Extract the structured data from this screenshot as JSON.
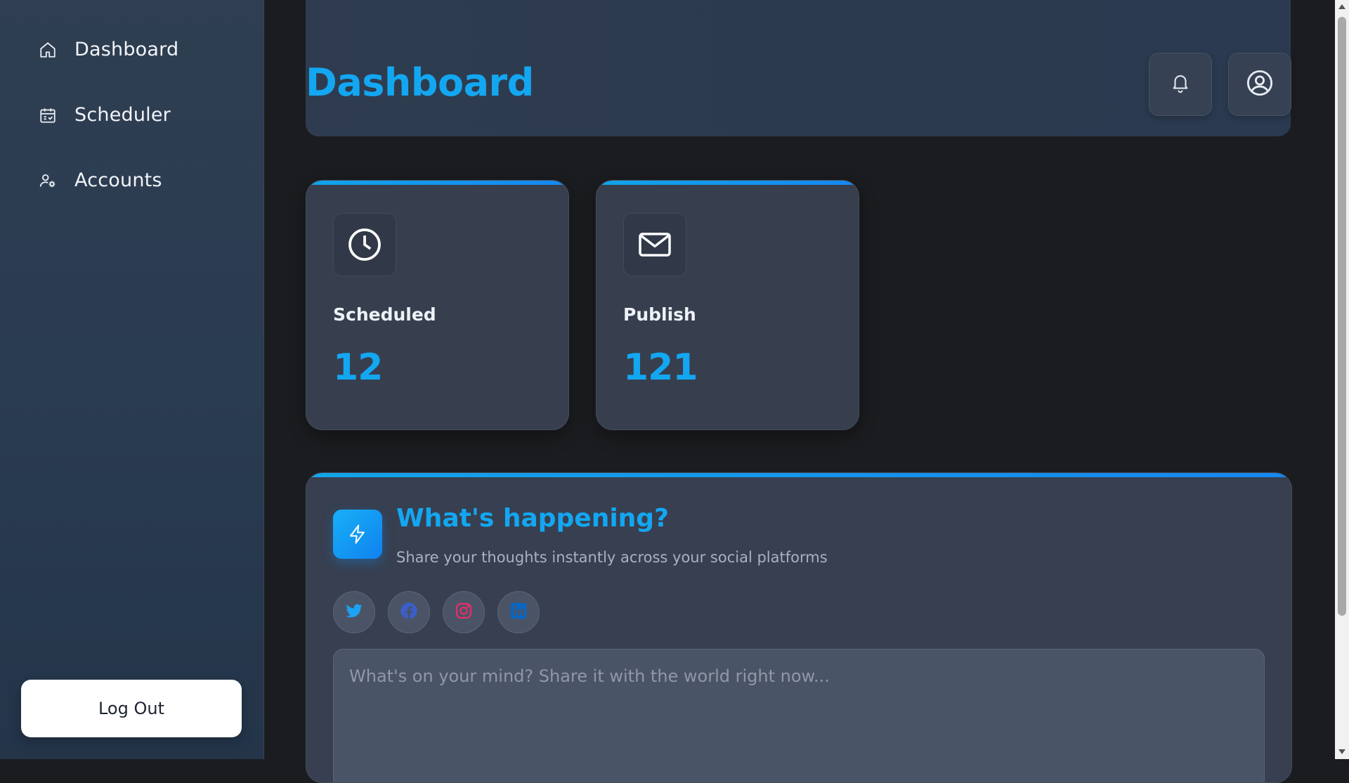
{
  "sidebar": {
    "items": [
      {
        "label": "Dashboard",
        "icon": "home-icon"
      },
      {
        "label": "Scheduler",
        "icon": "calendar-icon"
      },
      {
        "label": "Accounts",
        "icon": "user-settings-icon"
      }
    ],
    "logout_label": "Log Out"
  },
  "header": {
    "title": "Dashboard",
    "notification_icon": "bell-icon",
    "profile_icon": "user-circle-icon"
  },
  "stats": [
    {
      "label": "Scheduled",
      "value": "12",
      "icon": "clock-icon"
    },
    {
      "label": "Publish",
      "value": "121",
      "icon": "mail-icon"
    }
  ],
  "composer": {
    "title": "What's happening?",
    "subtitle": "Share your thoughts instantly across your social platforms",
    "placeholder": "What's on your mind? Share it with the world right now...",
    "icon": "lightning-icon",
    "platforms": [
      {
        "name": "twitter",
        "icon": "twitter-icon",
        "color": "#1da1f2"
      },
      {
        "name": "facebook",
        "icon": "facebook-icon",
        "color": "#3b5ec8"
      },
      {
        "name": "instagram",
        "icon": "instagram-icon",
        "color": "#e1306c"
      },
      {
        "name": "linkedin",
        "icon": "linkedin-icon",
        "color": "#0a66c2"
      }
    ]
  },
  "colors": {
    "accent": "#13a7f2",
    "sidebar_bg": "#2a3c52",
    "page_bg": "#1b1c1f",
    "card_bg": "#373f4f"
  }
}
